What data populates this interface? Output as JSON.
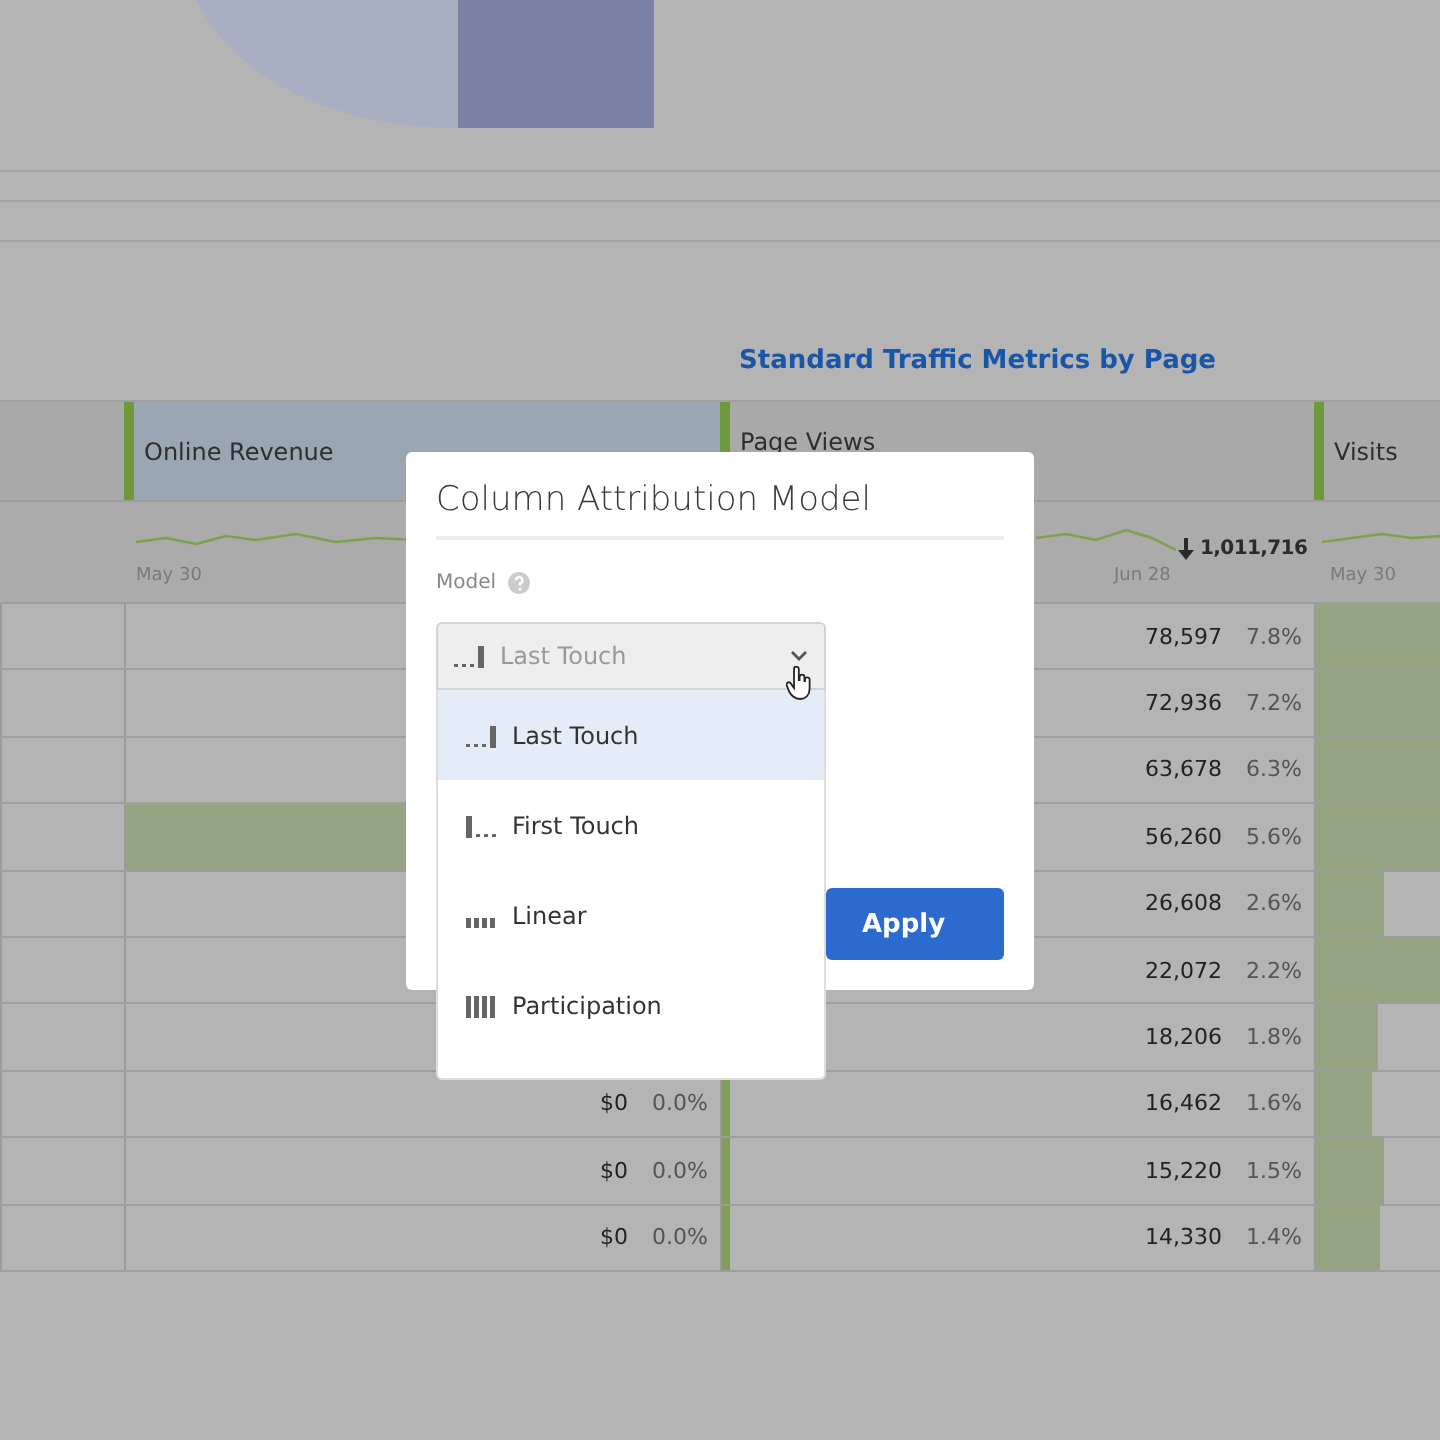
{
  "report_title": "Standard Traffic Metrics by Page",
  "columns": [
    {
      "label": "Online Revenue",
      "selected": true
    },
    {
      "label": "Page Views",
      "selected": false
    },
    {
      "label": "Visits",
      "selected": false
    }
  ],
  "trend": {
    "revenue_start": "May 30",
    "views_end": "Jun 28",
    "views_total": "1,011,716",
    "visits_start": "May 30"
  },
  "rows": [
    {
      "revenue": null,
      "views": {
        "value": "78,597",
        "percent": "7.8%"
      },
      "visits": {
        "level": 1
      }
    },
    {
      "revenue": null,
      "views": {
        "value": "72,936",
        "percent": "7.2%"
      },
      "visits": {
        "level": 1
      }
    },
    {
      "revenue": null,
      "views": {
        "value": "63,678",
        "percent": "6.3%"
      },
      "visits": {
        "level": 1
      }
    },
    {
      "revenue": {
        "level": 0.6
      },
      "views": {
        "value": "56,260",
        "percent": "5.6%"
      },
      "visits": {
        "level": 1
      }
    },
    {
      "revenue": null,
      "views": {
        "value": "26,608",
        "percent": "2.6%"
      },
      "visits": {
        "level": 0.55
      }
    },
    {
      "revenue": null,
      "views": {
        "value": "22,072",
        "percent": "2.2%"
      },
      "visits": {
        "level": 1
      }
    },
    {
      "revenue": null,
      "views": {
        "value": "18,206",
        "percent": "1.8%"
      },
      "visits": {
        "level": 0.5
      }
    },
    {
      "revenue": {
        "value": "$0",
        "percent": "0.0%"
      },
      "views": {
        "value": "16,462",
        "percent": "1.6%",
        "level": 0.015
      },
      "visits": {
        "level": 0.45
      }
    },
    {
      "revenue": {
        "value": "$0",
        "percent": "0.0%"
      },
      "views": {
        "value": "15,220",
        "percent": "1.5%",
        "level": 0.015
      },
      "visits": {
        "level": 0.55
      }
    },
    {
      "revenue": {
        "value": "$0",
        "percent": "0.0%"
      },
      "views": {
        "value": "14,330",
        "percent": "1.4%",
        "level": 0.015
      },
      "visits": {
        "level": 0.52
      }
    }
  ],
  "dialog": {
    "title": "Column Attribution Model",
    "field_label": "Model",
    "select_value": "Last Touch",
    "apply": "Apply",
    "options": [
      {
        "label": "Last Touch",
        "kind": "last",
        "selected": true
      },
      {
        "label": "First Touch",
        "kind": "first",
        "selected": false
      },
      {
        "label": "Linear",
        "kind": "linear",
        "selected": false
      },
      {
        "label": "Participation",
        "kind": "participation",
        "selected": false
      }
    ]
  }
}
